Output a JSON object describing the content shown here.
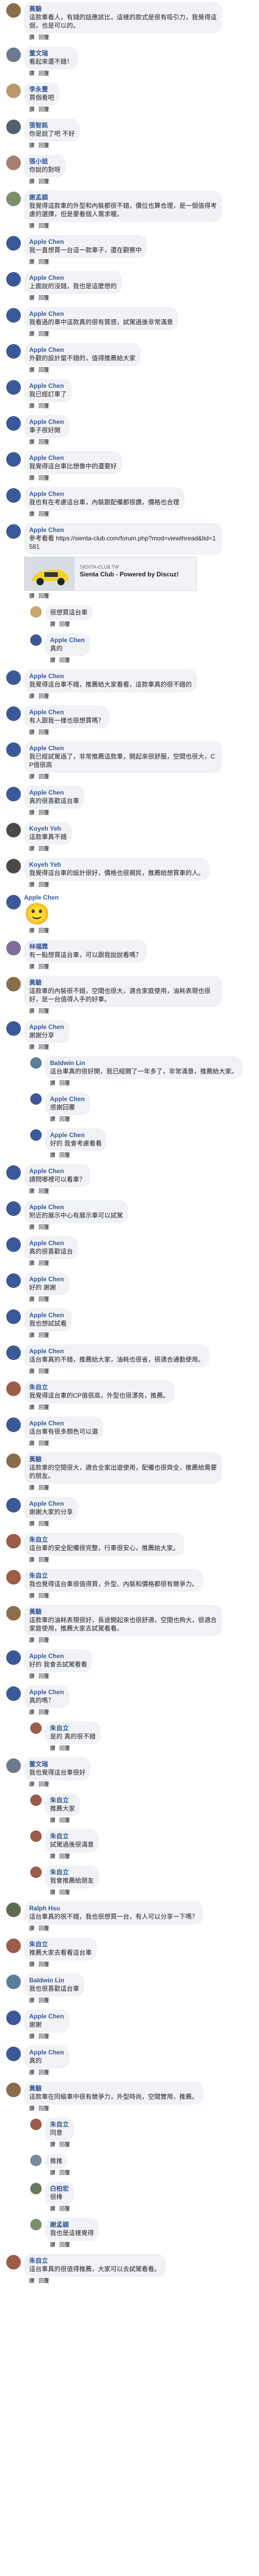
{
  "comments": [
    {
      "level": 0,
      "author": "",
      "text": "",
      "likes": ""
    },
    {
      "level": 0,
      "author": "Apple Chen",
      "text": "",
      "likes": ""
    }
  ]
}
